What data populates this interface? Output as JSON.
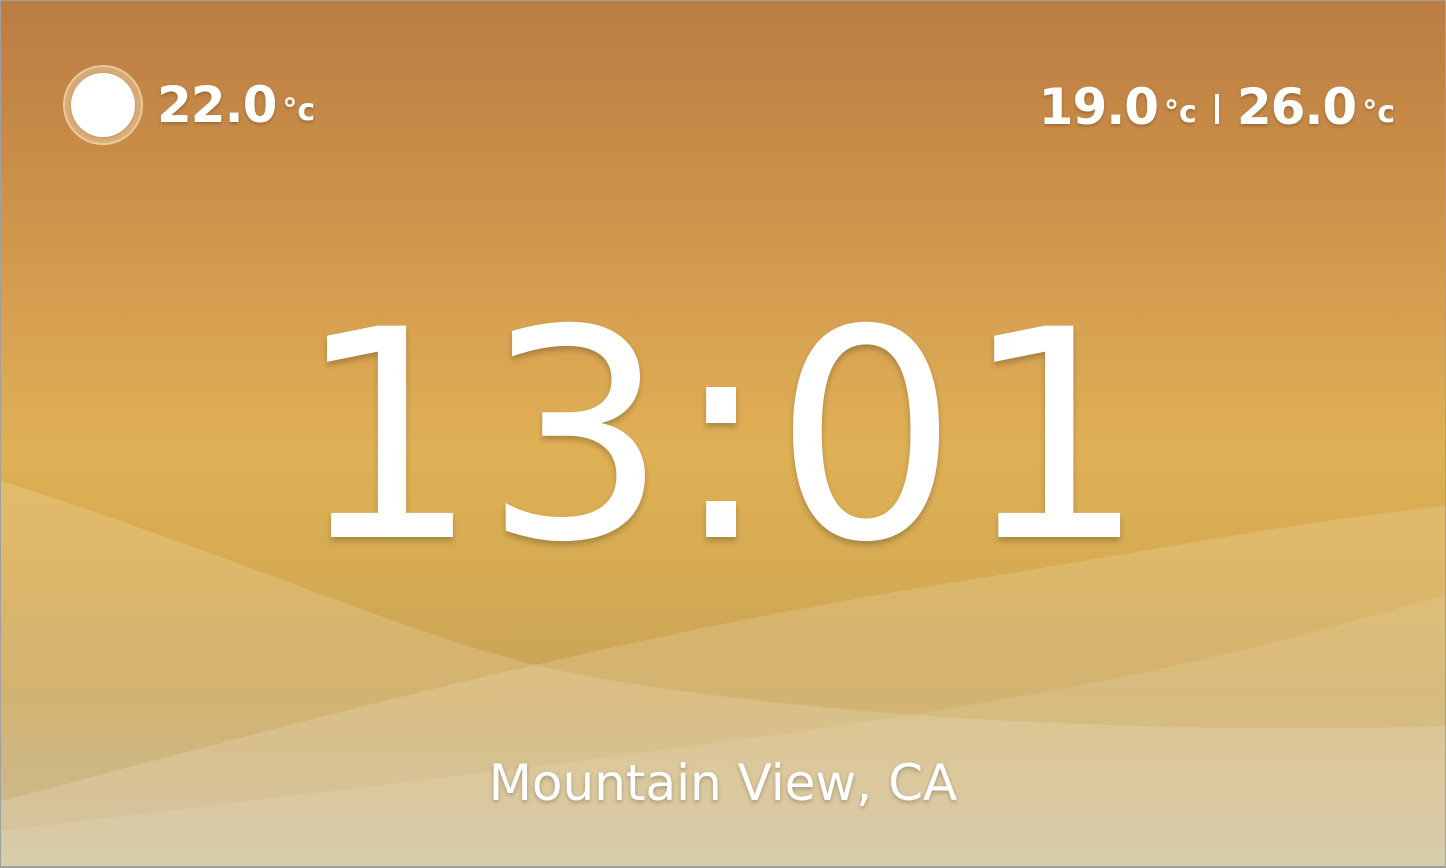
{
  "current_weather": {
    "icon": "sun-icon",
    "temperature": "22.0",
    "unit": "°c"
  },
  "forecast_range": {
    "low": "19.0",
    "low_unit": "°c",
    "high": "26.0",
    "high_unit": "°c"
  },
  "clock": {
    "time": "13:01"
  },
  "location": {
    "name": "Mountain View, CA"
  },
  "colors": {
    "sky_top": "#bb7c43",
    "sky_mid": "#dfb055",
    "sky_bottom": "#bdb08a",
    "text": "#ffffff"
  }
}
